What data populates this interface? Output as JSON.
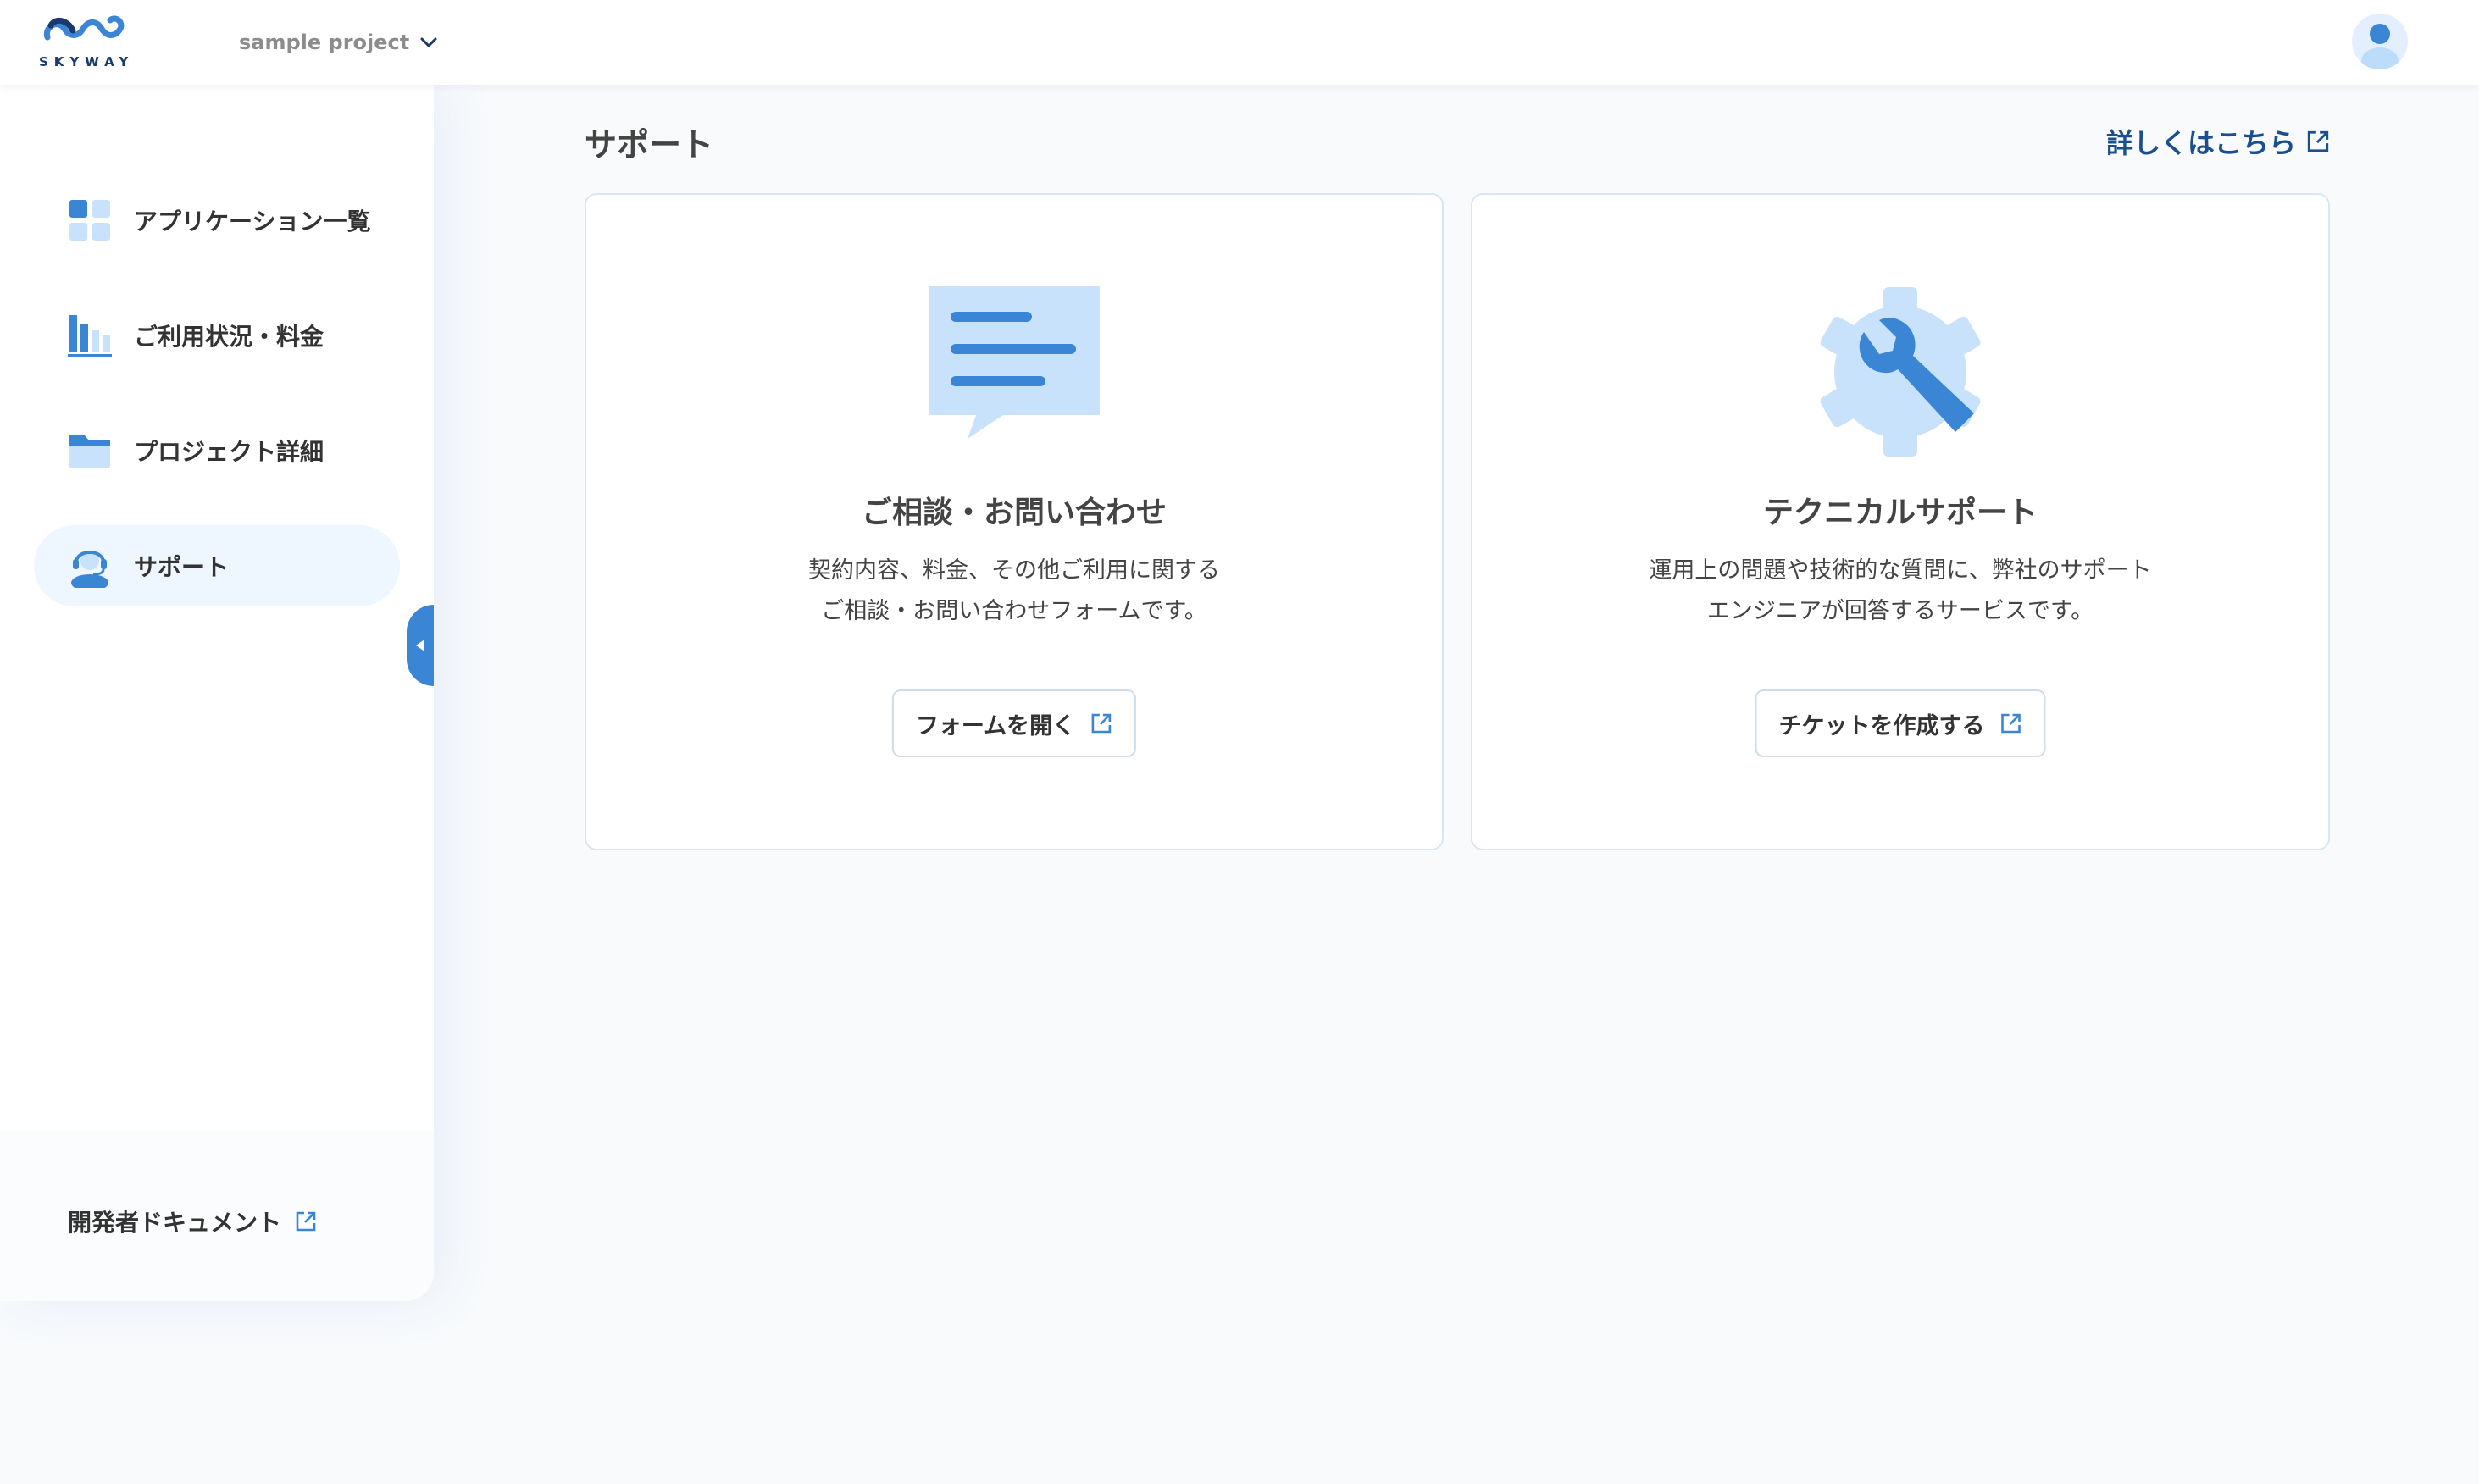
{
  "header": {
    "logo_text": "SKYWAY",
    "project_name": "sample project"
  },
  "sidebar": {
    "items": [
      {
        "label": "アプリケーション一覧",
        "icon": "grid-icon"
      },
      {
        "label": "ご利用状況・料金",
        "icon": "bar-chart-icon"
      },
      {
        "label": "プロジェクト詳細",
        "icon": "folder-icon"
      },
      {
        "label": "サポート",
        "icon": "headset-icon",
        "active": true
      }
    ],
    "footer_link": "開発者ドキュメント"
  },
  "main": {
    "title": "サポート",
    "more_link": "詳しくはこちら",
    "cards": [
      {
        "icon": "chat-bubble-icon",
        "title": "ご相談・お問い合わせ",
        "desc_line1": "契約内容、料金、その他ご利用に関する",
        "desc_line2": "ご相談・お問い合わせフォームです。",
        "button": "フォームを開く"
      },
      {
        "icon": "gear-wrench-icon",
        "title": "テクニカルサポート",
        "desc_line1": "運用上の問題や技術的な質問に、弊社のサポート",
        "desc_line2": "エンジニアが回答するサービスです。",
        "button": "チケットを作成する"
      }
    ]
  },
  "colors": {
    "accent": "#3a86d4",
    "accent_light": "#c9e2fb",
    "link": "#1a4f8f",
    "active_bg": "#eef6ff"
  }
}
